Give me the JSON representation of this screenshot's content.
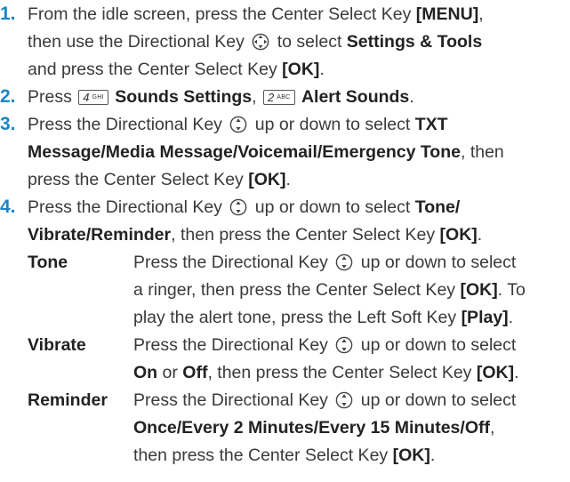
{
  "colors": {
    "accent": "#1a86c7",
    "text": "#3a3a3a"
  },
  "icons": {
    "dir4": "four-way-directional-key-icon",
    "dir2": "up-down-directional-key-icon"
  },
  "steps": [
    {
      "num": "1.",
      "l1a": "From the idle screen, press the Center Select Key ",
      "l1b": "[MENU]",
      "l1c": ",",
      "l2a": "then use the Directional Key",
      "l2b": "to select",
      "l2c": "Settings & Tools",
      "l3a": "and press the Center Select Key",
      "l3b": "[OK]",
      "l3c": "."
    },
    {
      "num": "2.",
      "a": "Press",
      "key1_digit": "4",
      "key1_letters": "GHI",
      "b1": "Sounds Settings",
      "c": ",",
      "key2_digit": "2",
      "key2_letters": "ABC",
      "b2": "Alert Sounds",
      "d": "."
    },
    {
      "num": "3.",
      "l1a": "Press the Directional Key",
      "l1b": "up or down to select",
      "l1c": "TXT",
      "l2a": "Message/Media Message/Voicemail/Emergency Tone",
      "l2b": ", then",
      "l3a": "press the Center Select Key",
      "l3b": "[OK]",
      "l3c": "."
    },
    {
      "num": "4.",
      "l1a": "Press the Directional Key",
      "l1b": "up or down to select",
      "l1c": "Tone/",
      "l2a": "Vibrate/Reminder",
      "l2b": ", then press the Center Select Key",
      "l2c": "[OK]",
      "l2d": "."
    }
  ],
  "options": [
    {
      "term": "Tone",
      "l1a": "Press the Directional Key",
      "l1b": "up or down to select",
      "l2a": "a ringer, then press the Center Select Key",
      "l2b": "[OK]",
      "l2c": ". To",
      "l3a": "play the alert tone, press the Left Soft Key",
      "l3b": "[Play]",
      "l3c": "."
    },
    {
      "term": "Vibrate",
      "l1a": "Press the Directional Key",
      "l1b": "up or down to select",
      "l2a": "On",
      "l2b": "or",
      "l2c": "Off",
      "l2d": ", then press the Center Select Key",
      "l2e": "[OK]",
      "l2f": "."
    },
    {
      "term": "Reminder",
      "l1a": "Press the Directional Key",
      "l1b": "up or down to select",
      "l2a": "Once/Every 2 Minutes/Every 15 Minutes/Off",
      "l2b": ",",
      "l3a": "then press the Center Select Key",
      "l3b": "[OK]",
      "l3c": "."
    }
  ]
}
